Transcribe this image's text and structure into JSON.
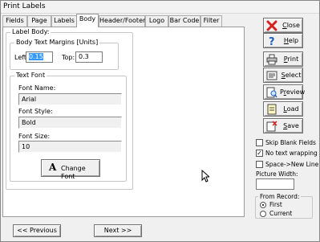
{
  "window": {
    "title": "Print Labels"
  },
  "tabs": [
    {
      "label": "Fields",
      "active": false
    },
    {
      "label": "Page",
      "active": false
    },
    {
      "label": "Labels",
      "active": false
    },
    {
      "label": "Body",
      "active": true
    },
    {
      "label": "Header/Footer",
      "active": false
    },
    {
      "label": "Logo",
      "active": false
    },
    {
      "label": "Bar Code",
      "active": false
    },
    {
      "label": "Filter",
      "active": false
    }
  ],
  "body": {
    "group_title": "Label Body:",
    "margins": {
      "title": "Body Text Margins [Units]",
      "left_label": "Left:",
      "left_value": "0.15",
      "top_label": "Top:",
      "top_value": "0.3"
    },
    "text_font": {
      "title": "Text Font",
      "font_name_label": "Font Name:",
      "font_name_value": "Arial",
      "font_style_label": "Font Style:",
      "font_style_value": "Bold",
      "font_size_label": "Font Size:",
      "font_size_value": "10",
      "change_font_button": "Change Font",
      "change_font_glyph": "A"
    }
  },
  "sidebar": {
    "buttons": [
      {
        "label": "Close",
        "accel": "C",
        "rest": "lose",
        "icon": "close-x-icon"
      },
      {
        "label": "Help",
        "accel": "H",
        "rest": "elp",
        "icon": "help-question-icon"
      },
      {
        "label": "Print",
        "accel": "P",
        "rest": "rint",
        "icon": "printer-icon"
      },
      {
        "label": "Select",
        "accel": "S",
        "rest": "elect",
        "icon": "select-icon"
      },
      {
        "label": "Preview",
        "accel": "r",
        "pre": "P",
        "rest": "eview",
        "icon": "preview-icon"
      },
      {
        "label": "Load",
        "accel": "L",
        "rest": "oad",
        "icon": "load-icon"
      },
      {
        "label": "Save",
        "accel": "S",
        "rest": "ave",
        "icon": "save-icon"
      }
    ],
    "options": [
      {
        "label": "Skip Blank Fields",
        "checked": false
      },
      {
        "label": "No text wrapping",
        "checked": true
      },
      {
        "label": "Space->New Line",
        "checked": false
      }
    ],
    "picture_width_label": "Picture Width:",
    "picture_width_value": "",
    "from_record": {
      "title": "From Record:",
      "options": [
        {
          "label": "First",
          "selected": true
        },
        {
          "label": "Current",
          "selected": false
        }
      ]
    }
  },
  "footer": {
    "previous_button": "<< Previous",
    "previous_accel": "P",
    "next_button": "Next >>",
    "next_accel": "N"
  },
  "colors": {
    "accent_red": "#d62020",
    "accent_blue": "#1f5fbf",
    "selection": "#3399ff"
  }
}
